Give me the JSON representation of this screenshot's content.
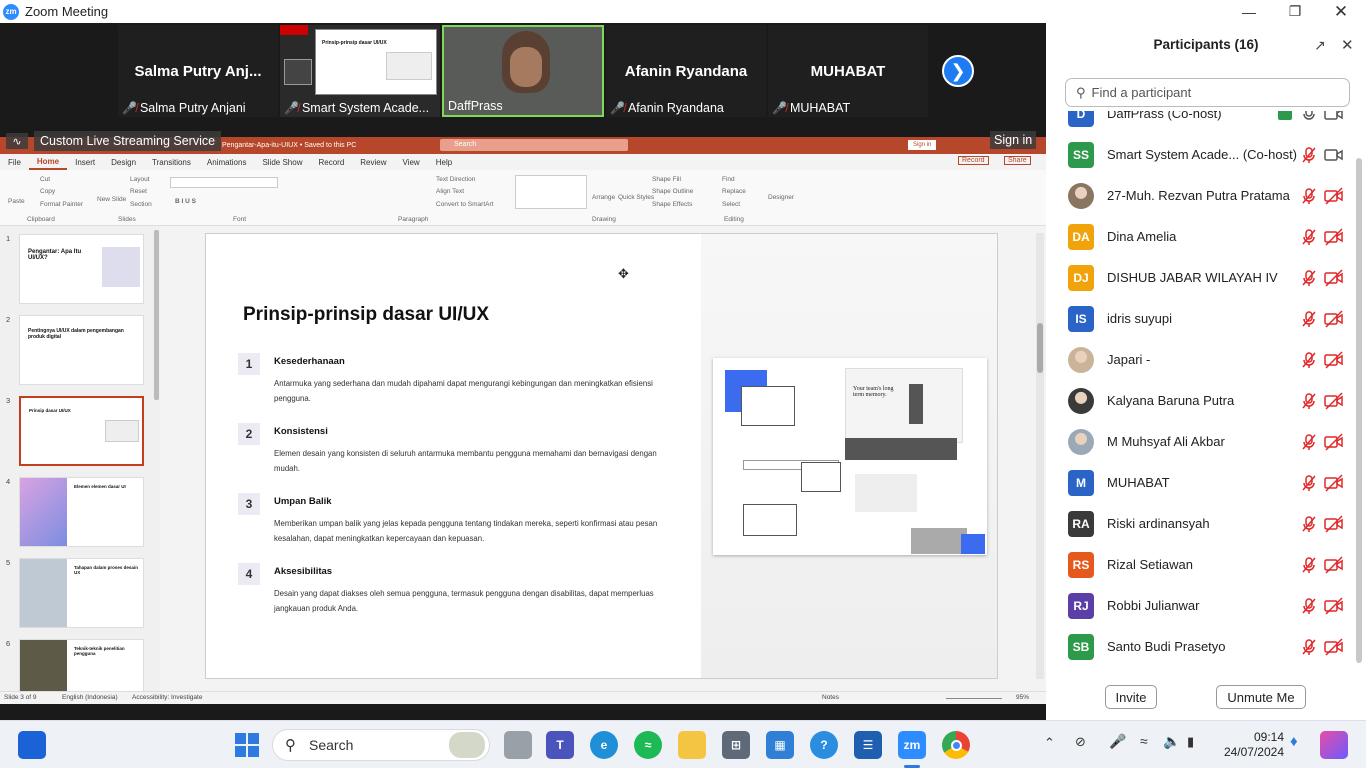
{
  "window": {
    "title": "Zoom Meeting",
    "logo_text": "zm"
  },
  "video_tiles": [
    {
      "big_name": "Salma Putry Anj...",
      "label": "Salma Putry Anjani",
      "muted": true
    },
    {
      "big_name": "",
      "label": "Smart System Acade...",
      "muted": true
    },
    {
      "big_name": "",
      "label": "DaffPrass",
      "muted": false
    },
    {
      "big_name": "Afanin Ryandana",
      "label": "Afanin Ryandana",
      "muted": true
    },
    {
      "big_name": "MUHABAT",
      "label": "MUHABAT",
      "muted": true
    }
  ],
  "shared_thumb_title": "Prinsip-prinsip dasar UI/UX",
  "live_stream": {
    "label": "Custom Live Streaming Service",
    "signin": "Sign in"
  },
  "ppt": {
    "title": "Pengantar-Apa-itu-UIUX • Saved to this PC",
    "search": "Search",
    "signin": "Sign in",
    "menu": [
      "File",
      "Home",
      "Insert",
      "Design",
      "Transitions",
      "Animations",
      "Slide Show",
      "Record",
      "Review",
      "View",
      "Help"
    ],
    "active_menu": "Home",
    "record_btn": "Record",
    "share_btn": "Share",
    "ribbon_groups": [
      "Clipboard",
      "Slides",
      "Font",
      "Paragraph",
      "Drawing",
      "Editing"
    ],
    "ribbon_items": {
      "paste": "Paste",
      "cut": "Cut",
      "copy": "Copy",
      "format_painter": "Format Painter",
      "new_slide": "New Slide",
      "layout": "Layout",
      "reset": "Reset",
      "section": "Section",
      "text_direction": "Text Direction",
      "align_text": "Align Text",
      "convert_smartart": "Convert to SmartArt",
      "arrange": "Arrange",
      "quick_styles": "Quick Styles",
      "shape_fill": "Shape Fill",
      "shape_outline": "Shape Outline",
      "shape_effects": "Shape Effects",
      "find": "Find",
      "replace": "Replace",
      "select": "Select",
      "designer": "Designer"
    },
    "thumbnails": [
      {
        "num": "1",
        "title": "Pengantar: Apa Itu UI/UX?"
      },
      {
        "num": "2",
        "title": "Pentingnya UI/UX dalam pengembangan produk digital"
      },
      {
        "num": "3",
        "title": "Prinsip dasar UI/UX"
      },
      {
        "num": "4",
        "title": "Elemen elemen dasar UI"
      },
      {
        "num": "5",
        "title": "Tahapan dalam proses desain UX"
      },
      {
        "num": "6",
        "title": "Teknik-teknik penelitian pengguna"
      }
    ],
    "slide": {
      "title": "Prinsip-prinsip dasar UI/UX",
      "points": [
        {
          "num": "1",
          "head": "Kesederhanaan",
          "body": "Antarmuka yang sederhana dan mudah dipahami dapat mengurangi kebingungan dan meningkatkan efisiensi pengguna."
        },
        {
          "num": "2",
          "head": "Konsistensi",
          "body": "Elemen desain yang konsisten di seluruh antarmuka membantu pengguna memahami dan bernavigasi dengan mudah."
        },
        {
          "num": "3",
          "head": "Umpan Balik",
          "body": "Memberikan umpan balik yang jelas kepada pengguna tentang tindakan mereka, seperti konfirmasi atau pesan kesalahan, dapat meningkatkan kepercayaan dan kepuasan."
        },
        {
          "num": "4",
          "head": "Aksesibilitas",
          "body": "Desain yang dapat diakses oleh semua pengguna, termasuk pengguna dengan disabilitas, dapat memperluas jangkauan produk Anda."
        }
      ],
      "mockup_text": "Your team's long term memory."
    },
    "status": {
      "slide_of": "Slide 3 of 9",
      "language": "English (Indonesia)",
      "accessibility": "Accessibility: Investigate",
      "notes": "Notes",
      "zoom": "95%"
    }
  },
  "participants": {
    "title": "Participants (16)",
    "search_placeholder": "Find a participant",
    "list": [
      {
        "initials": "D",
        "color": "#2b64c7",
        "name": "DaffPrass (Co-host)",
        "photo": false
      },
      {
        "initials": "SS",
        "color": "#2d9a4b",
        "name": "Smart System Acade...  (Co-host)",
        "photo": false
      },
      {
        "initials": "",
        "color": "#8a7560",
        "name": "27-Muh. Rezvan Putra Pratama",
        "photo": true
      },
      {
        "initials": "DA",
        "color": "#f0a30a",
        "name": "Dina Amelia",
        "photo": false
      },
      {
        "initials": "DJ",
        "color": "#f0a30a",
        "name": "DISHUB JABAR WILAYAH IV",
        "photo": false
      },
      {
        "initials": "IS",
        "color": "#2b64c7",
        "name": "idris suyupi",
        "photo": false
      },
      {
        "initials": "",
        "color": "#c9b49a",
        "name": "Japari -",
        "photo": true
      },
      {
        "initials": "",
        "color": "#3a3a3a",
        "name": "Kalyana Baruna Putra",
        "photo": true
      },
      {
        "initials": "",
        "color": "#9aa8b8",
        "name": "M Muhsyaf Ali Akbar",
        "photo": true
      },
      {
        "initials": "M",
        "color": "#2b64c7",
        "name": "MUHABAT",
        "photo": false
      },
      {
        "initials": "RA",
        "color": "#3a3a3a",
        "name": "Riski ardinansyah",
        "photo": false
      },
      {
        "initials": "RS",
        "color": "#e55a1c",
        "name": "Rizal Setiawan",
        "photo": false
      },
      {
        "initials": "RJ",
        "color": "#5b3fa6",
        "name": "Robbi Julianwar",
        "photo": false
      },
      {
        "initials": "SB",
        "color": "#2d9a4b",
        "name": "Santo Budi Prasetyo",
        "photo": false
      }
    ],
    "invite_label": "Invite",
    "unmute_label": "Unmute Me"
  },
  "taskbar": {
    "search_label": "Search",
    "time": "09:14",
    "date": "24/07/2024"
  },
  "colors": {
    "zoom_blue": "#2d8cff",
    "ppt_red": "#b7472a",
    "mute_red": "#e02828"
  }
}
